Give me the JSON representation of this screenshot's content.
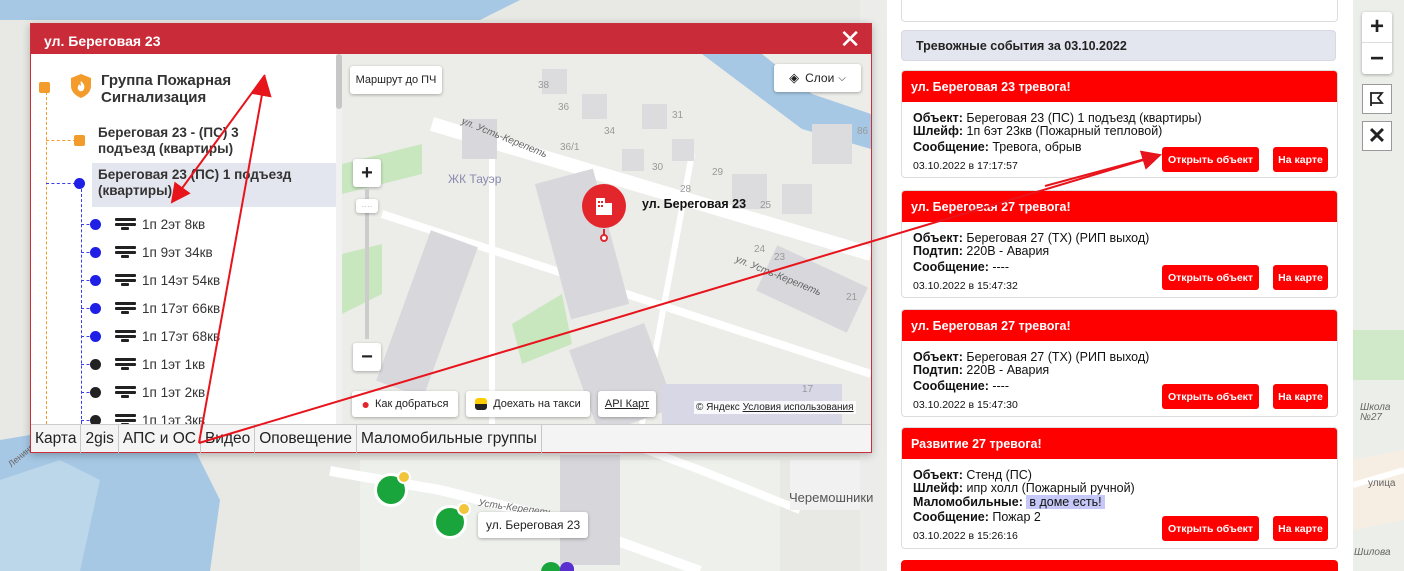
{
  "popup": {
    "title": "ул. Береговая 23",
    "close": "✕"
  },
  "tree": {
    "root": "Группа Пожарная Сигнализация",
    "objects": [
      "Береговая 23 - (ПС) 3 подъезд (квартиры)",
      "Береговая 23 (ПС) 1 подъезд (квартиры)"
    ],
    "loops": [
      "1п 2эт 8кв",
      "1п 9эт 34кв",
      "1п 14эт 54кв",
      "1п 17эт 66кв",
      "1п 17эт 68кв",
      "1п 1эт 1кв",
      "1п 1эт 2кв",
      "1п 1эт 3кв"
    ]
  },
  "minimap": {
    "route_button": "Маршрут до ПЧ",
    "layers_button": "Слои",
    "marker_label": "ул. Береговая 23",
    "place_label": "ЖК Тауэр",
    "street1": "ул. Усть-Керепеть",
    "street2": "ул. Усть-Керепеть",
    "how_to_get": "Как добраться",
    "taxi": "Доехать на такси",
    "api": "API Карт",
    "copyright": "© Яндекс",
    "terms": "Условия использования",
    "house_numbers": [
      "38",
      "35",
      "36",
      "31",
      "34",
      "36/1",
      "30",
      "29",
      "28",
      "27",
      "25",
      "24",
      "23",
      "21",
      "17",
      "21",
      "86"
    ]
  },
  "tabs": [
    "Карта",
    "2gis",
    "АПС и ОС",
    "Видео",
    "Оповещение",
    "Маломобильные группы"
  ],
  "events": {
    "title": "Тревожные события за 03.10.2022",
    "open_label": "Открыть объект",
    "map_label": "На карте",
    "cards": [
      {
        "header": "ул. Береговая 23 тревога!",
        "l1k": "Объект:",
        "l1v": " Береговая 23 (ПС) 1 подъезд (квартиры)",
        "l2k": "Шлейф:",
        "l2v": " 1п 6эт 23кв (Пожарный тепловой)",
        "l3k": "Сообщение:",
        "l3v": " Тревога, обрыв",
        "time": "03.10.2022 в 17:17:57"
      },
      {
        "header": "ул. Береговая 27 тревога!",
        "l1k": "Объект:",
        "l1v": " Береговая 27 (ТХ) (РИП выход)",
        "l2k": "Подтип:",
        "l2v": " 220В - Авария",
        "l3k": "Сообщение:",
        "l3v": " ----",
        "time": "03.10.2022 в 15:47:32"
      },
      {
        "header": "ул. Береговая 27 тревога!",
        "l1k": "Объект:",
        "l1v": " Береговая 27 (ТХ) (РИП выход)",
        "l2k": "Подтип:",
        "l2v": " 220В - Авария",
        "l3k": "Сообщение:",
        "l3v": " ----",
        "time": "03.10.2022 в 15:47:30"
      },
      {
        "header": "Развитие 27 тревога!",
        "l1k": "Объект:",
        "l1v": " Стенд (ПС)",
        "l2k": "Шлейф:",
        "l2v": " ипр холл (Пожарный ручной)",
        "l4k": "Маломобильные:",
        "l4v": "в доме есть!",
        "l3k": "Сообщение:",
        "l3v": " Пожар 2",
        "time": "03.10.2022 в 15:26:16"
      }
    ]
  },
  "map": {
    "marker_tooltip": "ул. Береговая 23",
    "district": "Черемошники",
    "school": "Школа №27",
    "street_bottom": "улица",
    "street_right": "Шилова",
    "street_keepet": "Усть-Керепеть",
    "street_kerepet2": "Усть-Керепеть",
    "street_left": "Ленинградская",
    "controls": {
      "zoom_in": "+",
      "zoom_out": "−",
      "close": "✕"
    }
  },
  "colors": {
    "header_red": "#c92b39",
    "alarm_red": "#fe0000",
    "tree_orange": "#f39c2b",
    "tree_blue": "#1f1fe6"
  }
}
